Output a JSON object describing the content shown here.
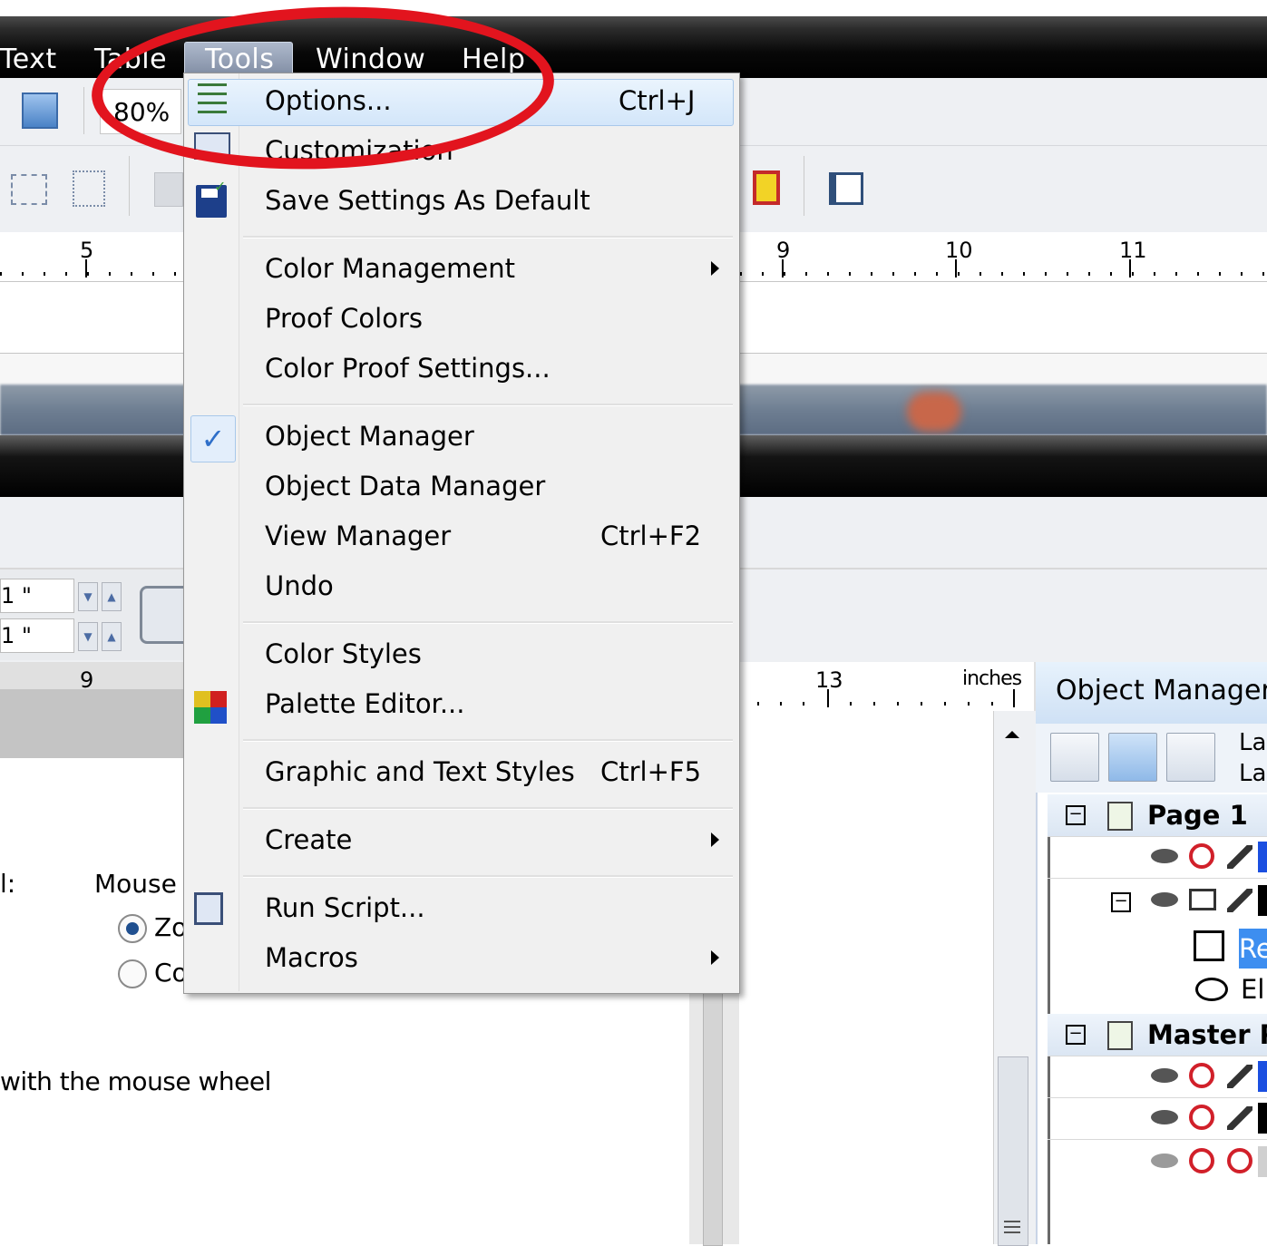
{
  "menubar": {
    "items": [
      "Text",
      "Table",
      "Tools",
      "Window",
      "Help"
    ]
  },
  "toolbar": {
    "zoom": "80%"
  },
  "ruler_top": {
    "labels": [
      "5",
      "9",
      "10",
      "11"
    ]
  },
  "ruler_bottom": {
    "labels": [
      "9",
      "13"
    ],
    "units": "inches"
  },
  "tools_menu": {
    "items": [
      {
        "label": "Options...",
        "shortcut": "Ctrl+J"
      },
      {
        "label": "Customization",
        "shortcut": ""
      },
      {
        "label": "Save Settings As Default",
        "shortcut": ""
      },
      {
        "label": "Color Management",
        "shortcut": "",
        "submenu": true
      },
      {
        "label": "Proof Colors",
        "shortcut": ""
      },
      {
        "label": "Color Proof Settings...",
        "shortcut": ""
      },
      {
        "label": "Object Manager",
        "shortcut": "",
        "checked": true
      },
      {
        "label": "Object Data Manager",
        "shortcut": ""
      },
      {
        "label": "View Manager",
        "shortcut": "Ctrl+F2"
      },
      {
        "label": "Undo",
        "shortcut": ""
      },
      {
        "label": "Color Styles",
        "shortcut": ""
      },
      {
        "label": "Palette Editor...",
        "shortcut": ""
      },
      {
        "label": "Graphic and Text Styles",
        "shortcut": "Ctrl+F5"
      },
      {
        "label": "Create",
        "shortcut": "",
        "submenu": true
      },
      {
        "label": "Run Script...",
        "shortcut": ""
      },
      {
        "label": "Macros",
        "shortcut": "",
        "submenu": true
      }
    ]
  },
  "fields": {
    "values": [
      "1 \"",
      "1 \""
    ]
  },
  "dialog": {
    "left_label": "l:",
    "mouse_label": "Mouse b",
    "radio1": "Zo",
    "radio2": "Co",
    "wheel_text": "with the mouse wheel"
  },
  "object_manager": {
    "title": "Object Manager",
    "layer_labels": [
      "La",
      "La"
    ],
    "page1": "Page 1",
    "child_re": "Re",
    "child_ell": "Ell",
    "master": "Master P"
  },
  "colors": {
    "highlight_ring": "#e2141e",
    "menu_bg": "#f0f0f0",
    "accent_blue": "#2f6fc9"
  }
}
